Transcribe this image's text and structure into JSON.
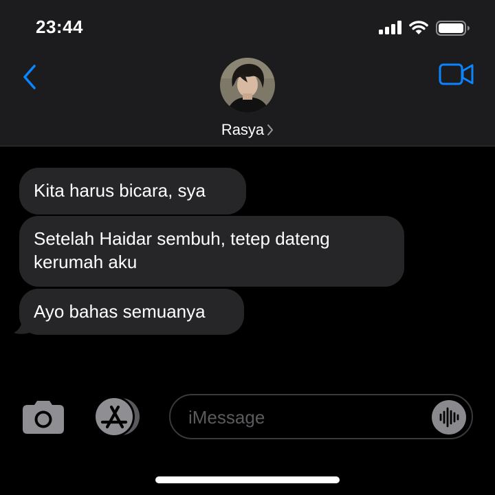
{
  "status_bar": {
    "time": "23:44"
  },
  "header": {
    "contact_name": "Rasya"
  },
  "messages": [
    {
      "text": "Kita harus bicara, sya",
      "direction": "incoming"
    },
    {
      "text": "Setelah Haidar sembuh, tetep dateng kerumah aku",
      "direction": "incoming"
    },
    {
      "text": "Ayo bahas semuanya",
      "direction": "incoming"
    }
  ],
  "composer": {
    "placeholder": "iMessage",
    "value": ""
  },
  "icons": {
    "back": "chevron-left-icon",
    "video": "video-camera-icon",
    "camera": "camera-icon",
    "app_store": "app-store-icon",
    "voice": "waveform-icon"
  },
  "colors": {
    "accent": "#0a84ff",
    "incoming_bubble": "#262629",
    "bar_background": "#1c1c1e",
    "background": "#000000"
  }
}
